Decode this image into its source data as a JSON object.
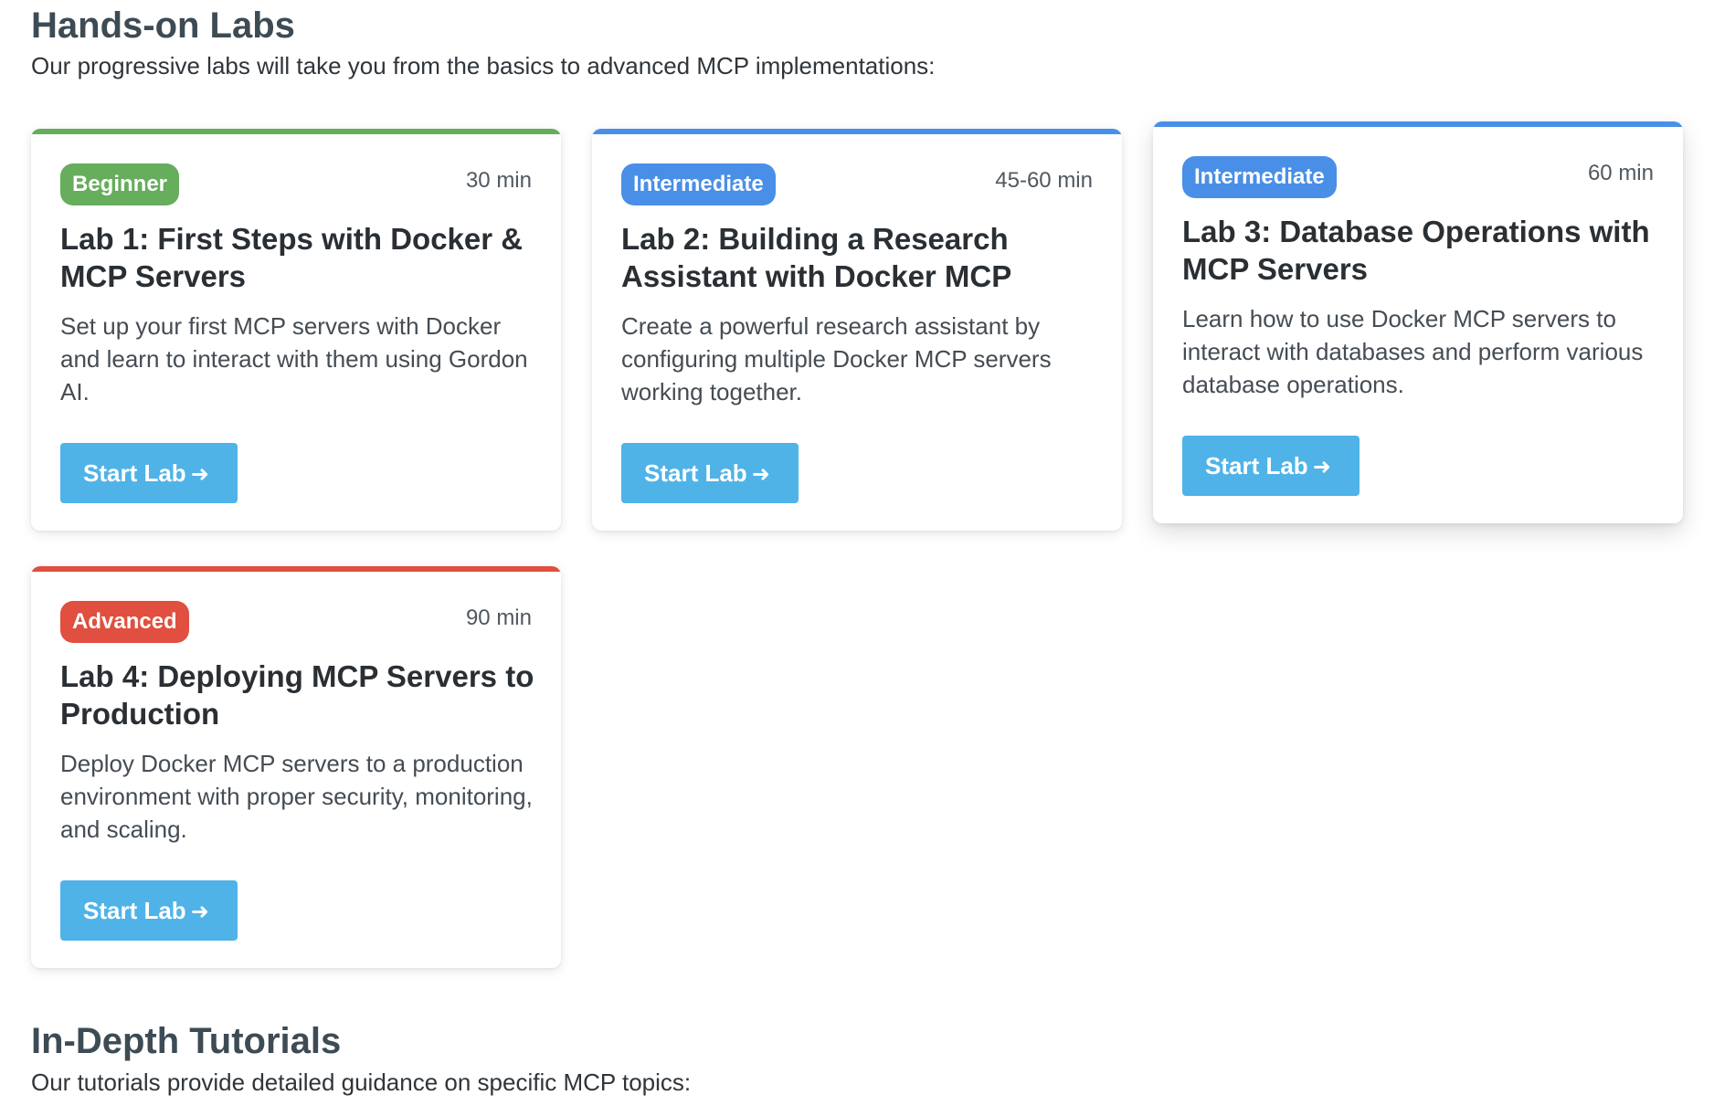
{
  "labs_section": {
    "title": "Hands-on Labs",
    "description": "Our progressive labs will take you from the basics to advanced MCP implementations:"
  },
  "labs": [
    {
      "level": "Beginner",
      "level_color": "#66ad5c",
      "duration": "30 min",
      "title": "Lab 1: First Steps with Docker & MCP Servers",
      "description": "Set up your first MCP servers with Docker and learn to interact with them using Gordon AI.",
      "button_label": "Start Lab",
      "button_icon": "arrow-right-icon"
    },
    {
      "level": "Intermediate",
      "level_color": "#4a8fe7",
      "duration": "45-60 min",
      "title": "Lab 2: Building a Research Assistant with Docker MCP",
      "description": "Create a powerful research assistant by configuring multiple Docker MCP servers working together.",
      "button_label": "Start Lab",
      "button_icon": "arrow-right-icon"
    },
    {
      "level": "Intermediate",
      "level_color": "#4a8fe7",
      "duration": "60 min",
      "title": "Lab 3: Database Operations with MCP Servers",
      "description": "Learn how to use Docker MCP servers to interact with databases and perform various database operations.",
      "button_label": "Start Lab",
      "button_icon": "arrow-right-icon"
    },
    {
      "level": "Advanced",
      "level_color": "#e04f3f",
      "duration": "90 min",
      "title": "Lab 4: Deploying MCP Servers to Production",
      "description": "Deploy Docker MCP servers to a production environment with proper security, monitoring, and scaling.",
      "button_label": "Start Lab",
      "button_icon": "arrow-right-icon"
    }
  ],
  "colors": {
    "button": "#4fb3e8",
    "heading": "#3d4b55"
  },
  "tutorials_section": {
    "title": "In-Depth Tutorials",
    "description": "Our tutorials provide detailed guidance on specific MCP topics:"
  }
}
